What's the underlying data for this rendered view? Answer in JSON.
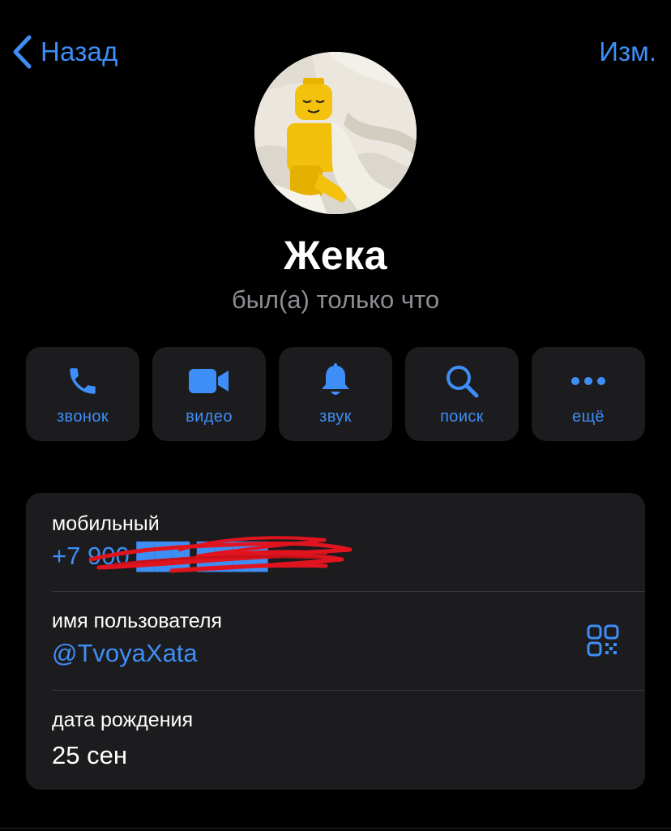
{
  "nav": {
    "back_label": "Назад",
    "edit_label": "Изм."
  },
  "profile": {
    "name": "Жека",
    "status": "был(а) только что",
    "avatar_icon": "lego-figure-avatar"
  },
  "actions": [
    {
      "label": "звонок",
      "icon": "phone-icon"
    },
    {
      "label": "видео",
      "icon": "video-camera-icon"
    },
    {
      "label": "звук",
      "icon": "bell-icon"
    },
    {
      "label": "поиск",
      "icon": "search-icon"
    },
    {
      "label": "ещё",
      "icon": "more-dots-icon"
    }
  ],
  "info": {
    "phone_label": "мобильный",
    "phone_value": "+7 900 ███ ████",
    "username_label": "имя пользователя",
    "username_value": "@TvoyaXata",
    "birthday_label": "дата рождения",
    "birthday_value": "25 сен"
  },
  "colors": {
    "accent": "#3e8ef7",
    "background": "#000000",
    "card": "#1c1c1e",
    "secondary_text": "#8d8d93",
    "redaction": "#e0141e"
  }
}
